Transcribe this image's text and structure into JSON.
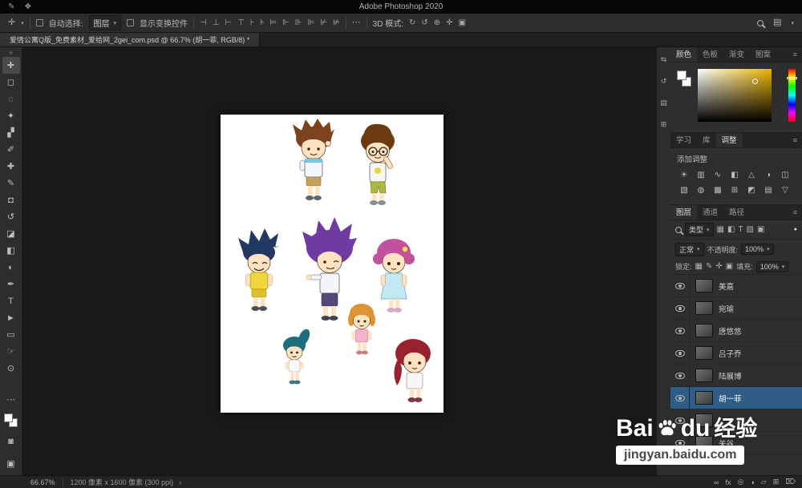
{
  "window": {
    "title": "Adobe Photoshop 2020"
  },
  "icons": {
    "apple": "✎",
    "app": "❖",
    "caret": "▾",
    "more": "⋯",
    "workspace": "▤",
    "chevron": "›",
    "dot": "●",
    "collapse": "»"
  },
  "options_bar": {
    "auto_select_label": "自动选择:",
    "auto_select_value": "图层",
    "show_transform_label": "显示变换控件",
    "mode_label": "3D 模式:",
    "align_icons": [
      {
        "name": "align-left",
        "glyph": "⊣"
      },
      {
        "name": "align-h-center",
        "glyph": "⊥"
      },
      {
        "name": "align-right",
        "glyph": "⊢"
      },
      {
        "name": "align-top",
        "glyph": "⊤"
      },
      {
        "name": "align-v-center",
        "glyph": "⊦"
      },
      {
        "name": "align-bottom",
        "glyph": "⊧"
      },
      {
        "name": "distribute-top",
        "glyph": "⊨"
      },
      {
        "name": "distribute-v-center",
        "glyph": "⊩"
      },
      {
        "name": "distribute-bottom",
        "glyph": "⊪"
      },
      {
        "name": "distribute-left",
        "glyph": "⊫"
      },
      {
        "name": "distribute-h-center",
        "glyph": "⊬"
      },
      {
        "name": "distribute-right",
        "glyph": "⊭"
      }
    ],
    "mode_icons": [
      {
        "name": "3d-rotate",
        "glyph": "↻"
      },
      {
        "name": "3d-roll",
        "glyph": "↺"
      },
      {
        "name": "3d-drag",
        "glyph": "⊕"
      },
      {
        "name": "3d-slide",
        "glyph": "✛"
      },
      {
        "name": "3d-scale",
        "glyph": "▣"
      }
    ]
  },
  "document": {
    "tab_title": "爱情公寓Q版_免费素材_爱给网_2gei_com.psd @ 66.7% (胡一菲, RGB/8) *"
  },
  "tools": [
    {
      "name": "move",
      "glyph": "✛"
    },
    {
      "name": "marquee",
      "glyph": "◻"
    },
    {
      "name": "lasso",
      "glyph": "◌"
    },
    {
      "name": "quick-select",
      "glyph": "✦"
    },
    {
      "name": "crop",
      "glyph": "▞"
    },
    {
      "name": "eyedropper",
      "glyph": "✐"
    },
    {
      "name": "healing-brush",
      "glyph": "✚"
    },
    {
      "name": "brush",
      "glyph": "✎"
    },
    {
      "name": "clone-stamp",
      "glyph": "◘"
    },
    {
      "name": "history-brush",
      "glyph": "↺"
    },
    {
      "name": "eraser",
      "glyph": "◪"
    },
    {
      "name": "gradient",
      "glyph": "◧"
    },
    {
      "name": "dodge",
      "glyph": "◐"
    },
    {
      "name": "pen",
      "glyph": "✒"
    },
    {
      "name": "type",
      "glyph": "T"
    },
    {
      "name": "path-select",
      "glyph": "►"
    },
    {
      "name": "shape",
      "glyph": "▭"
    },
    {
      "name": "hand",
      "glyph": "☞"
    },
    {
      "name": "zoom",
      "glyph": "⊙"
    }
  ],
  "tools_bottom": [
    {
      "name": "edit-toolbar",
      "glyph": "⋯"
    },
    {
      "name": "quick-mask",
      "glyph": "◙"
    },
    {
      "name": "screen-mode",
      "glyph": "▣"
    }
  ],
  "side_strip": [
    {
      "name": "collapse-panels",
      "glyph": "⇆"
    },
    {
      "name": "history",
      "glyph": "↺"
    },
    {
      "name": "properties",
      "glyph": "▤"
    },
    {
      "name": "libraries",
      "glyph": "⊞"
    }
  ],
  "panels": {
    "color": {
      "tabs": [
        "颜色",
        "色板",
        "渐变",
        "图案"
      ],
      "swatch_color": "#e8b400"
    },
    "adjustments": {
      "tabs": [
        "学习",
        "库",
        "调整"
      ],
      "add_label": "添加调整",
      "icons_row1": [
        {
          "name": "brightness-contrast",
          "glyph": "☀"
        },
        {
          "name": "levels",
          "glyph": "▥"
        },
        {
          "name": "curves",
          "glyph": "∿"
        },
        {
          "name": "exposure",
          "glyph": "◧"
        },
        {
          "name": "vibrance",
          "glyph": "△"
        },
        {
          "name": "hue-saturation",
          "glyph": "◑"
        },
        {
          "name": "color-balance",
          "glyph": "◫"
        }
      ],
      "icons_row2": [
        {
          "name": "black-white",
          "glyph": "▧"
        },
        {
          "name": "photo-filter",
          "glyph": "◍"
        },
        {
          "name": "channel-mixer",
          "glyph": "▩"
        },
        {
          "name": "color-lookup",
          "glyph": "⊞"
        },
        {
          "name": "invert",
          "glyph": "◩"
        },
        {
          "name": "posterize",
          "glyph": "▤"
        },
        {
          "name": "threshold",
          "glyph": "▽"
        }
      ]
    },
    "layers": {
      "tabs": [
        "图层",
        "通道",
        "路径"
      ],
      "filter_label": "类型",
      "filter_icons": [
        {
          "name": "filter-pixel",
          "glyph": "▦"
        },
        {
          "name": "filter-adjustment",
          "glyph": "◧"
        },
        {
          "name": "filter-type",
          "glyph": "T"
        },
        {
          "name": "filter-shape",
          "glyph": "▨"
        },
        {
          "name": "filter-smart",
          "glyph": "▣"
        }
      ],
      "blend_mode": "正常",
      "opacity_label": "不透明度:",
      "opacity_value": "100%",
      "lock_label": "锁定:",
      "lock_icons": [
        {
          "name": "lock-transparency",
          "glyph": "▦"
        },
        {
          "name": "lock-pixels",
          "glyph": "✎"
        },
        {
          "name": "lock-position",
          "glyph": "✛"
        },
        {
          "name": "lock-all",
          "glyph": "▣"
        }
      ],
      "fill_label": "填充:",
      "fill_value": "100%",
      "items": [
        {
          "name": "美嘉",
          "selected": false
        },
        {
          "name": "宛瑜",
          "selected": false
        },
        {
          "name": "唐悠悠",
          "selected": false
        },
        {
          "name": "吕子乔",
          "selected": false
        },
        {
          "name": "陆展博",
          "selected": false
        },
        {
          "name": "胡一菲",
          "selected": true
        },
        {
          "name": "",
          "selected": false
        },
        {
          "name": "关谷",
          "selected": false
        }
      ],
      "footer_icons": [
        {
          "name": "link-layers",
          "glyph": "∞"
        },
        {
          "name": "layer-style",
          "glyph": "fx"
        },
        {
          "name": "layer-mask",
          "glyph": "◎"
        },
        {
          "name": "adjustment-layer",
          "glyph": "◑"
        },
        {
          "name": "layer-group",
          "glyph": "▱"
        },
        {
          "name": "new-layer",
          "glyph": "⊞"
        },
        {
          "name": "delete-layer",
          "glyph": "⌦"
        }
      ]
    }
  },
  "status_bar": {
    "zoom": "66.67%",
    "info": "1200 像素 x 1600 像素 (300 ppi)"
  },
  "watermark": {
    "brand_a": "Bai",
    "brand_b": "du",
    "brand_c": "经验",
    "url": "jingyan.baidu.com"
  },
  "colors": {
    "ui_background": "#2e2e2e",
    "canvas_background": "#191919",
    "selected_layer": "#2e5d88",
    "color_field_hue": "#e8b400"
  }
}
